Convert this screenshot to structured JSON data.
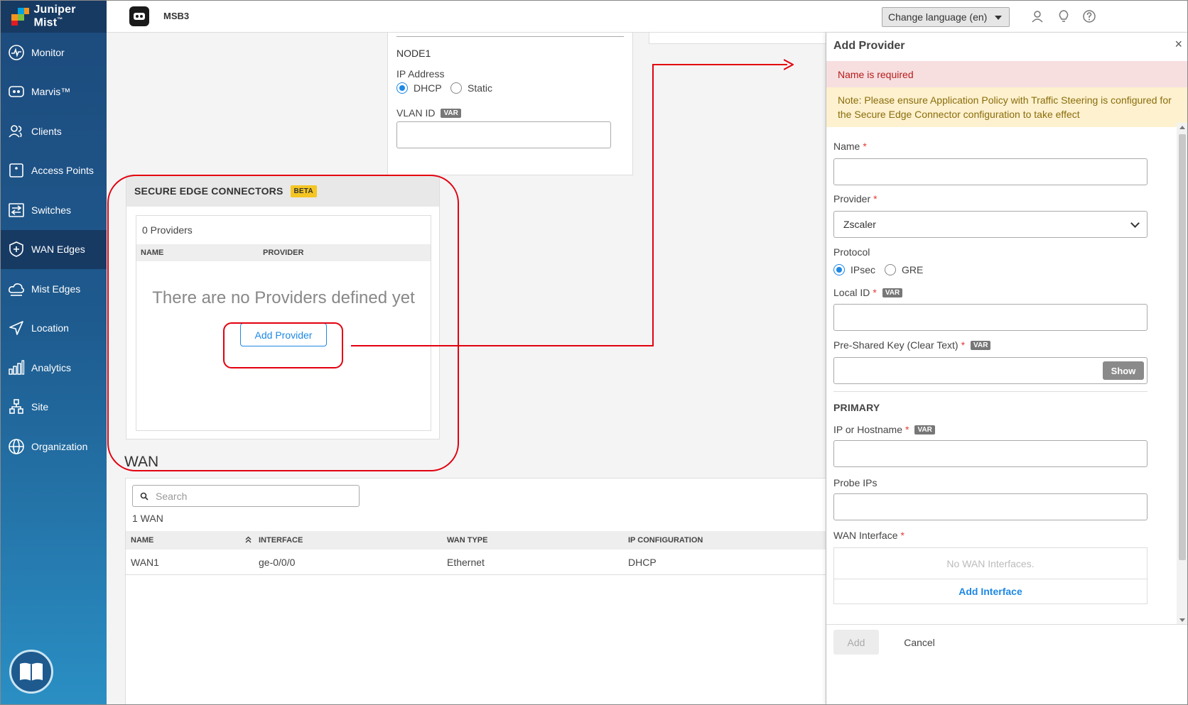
{
  "brand": {
    "name": "Juniper Mist",
    "tm": "™"
  },
  "sidebar": {
    "items": [
      {
        "label": "Monitor",
        "icon": "monitor-icon"
      },
      {
        "label": "Marvis™",
        "icon": "marvis-icon"
      },
      {
        "label": "Clients",
        "icon": "clients-icon"
      },
      {
        "label": "Access Points",
        "icon": "access-points-icon"
      },
      {
        "label": "Switches",
        "icon": "switches-icon"
      },
      {
        "label": "WAN Edges",
        "icon": "wan-edges-icon",
        "active": true
      },
      {
        "label": "Mist Edges",
        "icon": "mist-edges-icon"
      },
      {
        "label": "Location",
        "icon": "location-icon"
      },
      {
        "label": "Analytics",
        "icon": "analytics-icon"
      },
      {
        "label": "Site",
        "icon": "site-icon"
      },
      {
        "label": "Organization",
        "icon": "organization-icon"
      }
    ],
    "help_icon": "book-icon"
  },
  "topbar": {
    "site_name": "MSB3",
    "language_select": "Change language (en)",
    "icons": [
      "user-icon",
      "lightbulb-icon",
      "help-icon"
    ]
  },
  "node": {
    "title": "NODE1",
    "ip_label": "IP Address",
    "dhcp_label": "DHCP",
    "static_label": "Static",
    "ip_mode": "DHCP",
    "vlan_label": "VLAN ID",
    "var_badge": "VAR"
  },
  "secure_edge": {
    "title": "SECURE EDGE CONNECTORS",
    "badge": "BETA",
    "count": "0 Providers",
    "columns": [
      "NAME",
      "PROVIDER"
    ],
    "empty_message": "There are no Providers defined yet",
    "add_button": "Add Provider"
  },
  "wan": {
    "title": "WAN",
    "search_placeholder": "Search",
    "count": "1 WAN",
    "columns": [
      "NAME",
      "INTERFACE",
      "WAN TYPE",
      "IP CONFIGURATION"
    ],
    "rows": [
      {
        "name": "WAN1",
        "interface": "ge-0/0/0",
        "wan_type": "Ethernet",
        "ip_config": "DHCP"
      }
    ]
  },
  "drawer": {
    "title": "Add Provider",
    "close": "×",
    "error": "Name is required",
    "note": "Note: Please ensure Application Policy with Traffic Steering is configured for the Secure Edge Connector configuration to take effect",
    "name_label": "Name",
    "provider_label": "Provider",
    "provider_value": "Zscaler",
    "protocol_label": "Protocol",
    "protocol_ipsec": "IPsec",
    "protocol_gre": "GRE",
    "protocol_selected": "IPsec",
    "local_id_label": "Local ID",
    "psk_label": "Pre-Shared Key (Clear Text)",
    "show_button": "Show",
    "primary_title": "PRIMARY",
    "ip_hostname_label": "IP or Hostname",
    "probe_ips_label": "Probe IPs",
    "wan_interface_label": "WAN Interface",
    "no_wan_interfaces": "No WAN Interfaces.",
    "add_interface": "Add Interface",
    "var_badge": "VAR",
    "required_mark": "*",
    "add_button": "Add",
    "cancel_button": "Cancel"
  },
  "colors": {
    "accent": "#1e88e5",
    "annotation": "#e3000f",
    "error_bg": "#f7dfe0",
    "note_bg": "#fdf1cf",
    "beta_badge": "#f5c623"
  }
}
